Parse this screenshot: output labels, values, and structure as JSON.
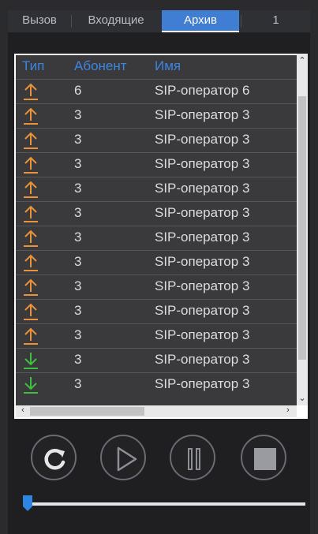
{
  "tabs": [
    {
      "label": "Вызов"
    },
    {
      "label": "Входящие"
    },
    {
      "label": "Архив"
    },
    {
      "label": "1"
    }
  ],
  "table": {
    "headers": {
      "type": "Тип",
      "subscriber": "Абонент",
      "name": "Имя"
    },
    "rows": [
      {
        "direction": "outgoing",
        "subscriber": "6",
        "name": "SIP-оператор 6"
      },
      {
        "direction": "outgoing",
        "subscriber": "3",
        "name": "SIP-оператор 3"
      },
      {
        "direction": "outgoing",
        "subscriber": "3",
        "name": "SIP-оператор 3"
      },
      {
        "direction": "outgoing",
        "subscriber": "3",
        "name": "SIP-оператор 3"
      },
      {
        "direction": "outgoing",
        "subscriber": "3",
        "name": "SIP-оператор 3"
      },
      {
        "direction": "outgoing",
        "subscriber": "3",
        "name": "SIP-оператор 3"
      },
      {
        "direction": "outgoing",
        "subscriber": "3",
        "name": "SIP-оператор 3"
      },
      {
        "direction": "outgoing",
        "subscriber": "3",
        "name": "SIP-оператор 3"
      },
      {
        "direction": "outgoing",
        "subscriber": "3",
        "name": "SIP-оператор 3"
      },
      {
        "direction": "outgoing",
        "subscriber": "3",
        "name": "SIP-оператор 3"
      },
      {
        "direction": "outgoing",
        "subscriber": "3",
        "name": "SIP-оператор 3"
      },
      {
        "direction": "incoming",
        "subscriber": "3",
        "name": "SIP-оператор 3"
      },
      {
        "direction": "incoming",
        "subscriber": "3",
        "name": "SIP-оператор 3"
      }
    ]
  },
  "colors": {
    "accent": "#3f7ed2",
    "header_text": "#3c85e0",
    "outgoing_arrow": "#e8923a",
    "incoming_arrow": "#3fbf3f"
  },
  "controls": [
    "refresh-icon",
    "play-icon",
    "pause-icon",
    "stop-icon"
  ],
  "playback": {
    "position_fraction": 0.0
  }
}
